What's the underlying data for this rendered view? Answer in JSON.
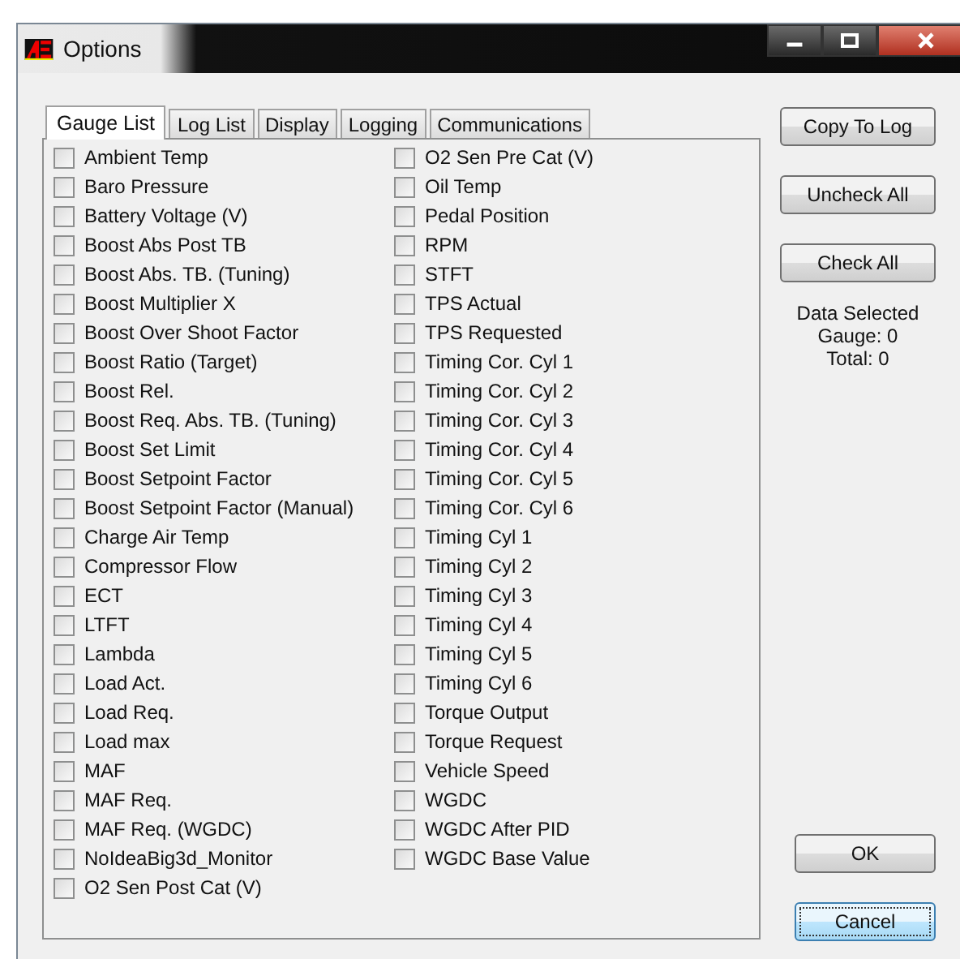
{
  "window": {
    "title": "Options"
  },
  "tabs": [
    {
      "label": "Gauge List",
      "selected": true
    },
    {
      "label": "Log List",
      "selected": false
    },
    {
      "label": "Display",
      "selected": false
    },
    {
      "label": "Logging",
      "selected": false
    },
    {
      "label": "Communications",
      "selected": false
    }
  ],
  "gauge_columns": [
    [
      {
        "label": "Ambient Temp",
        "checked": false
      },
      {
        "label": "Baro Pressure",
        "checked": false
      },
      {
        "label": "Battery Voltage (V)",
        "checked": false
      },
      {
        "label": "Boost Abs Post TB",
        "checked": false
      },
      {
        "label": "Boost Abs. TB. (Tuning)",
        "checked": false
      },
      {
        "label": "Boost Multiplier X",
        "checked": false
      },
      {
        "label": "Boost Over Shoot Factor",
        "checked": false
      },
      {
        "label": "Boost Ratio (Target)",
        "checked": false
      },
      {
        "label": "Boost Rel.",
        "checked": false
      },
      {
        "label": "Boost Req. Abs. TB. (Tuning)",
        "checked": false
      },
      {
        "label": "Boost Set Limit",
        "checked": false
      },
      {
        "label": "Boost Setpoint Factor",
        "checked": false
      },
      {
        "label": "Boost Setpoint Factor (Manual)",
        "checked": false
      },
      {
        "label": "Charge Air Temp",
        "checked": false
      },
      {
        "label": "Compressor Flow",
        "checked": false
      },
      {
        "label": "ECT",
        "checked": false
      },
      {
        "label": "LTFT",
        "checked": false
      },
      {
        "label": "Lambda",
        "checked": false
      },
      {
        "label": "Load Act.",
        "checked": false
      },
      {
        "label": "Load Req.",
        "checked": false
      },
      {
        "label": "Load max",
        "checked": false
      },
      {
        "label": "MAF",
        "checked": false
      },
      {
        "label": "MAF Req.",
        "checked": false
      },
      {
        "label": "MAF Req. (WGDC)",
        "checked": false
      },
      {
        "label": "NoIdeaBig3d_Monitor",
        "checked": false
      },
      {
        "label": "O2 Sen Post Cat (V)",
        "checked": false
      }
    ],
    [
      {
        "label": "O2 Sen Pre Cat (V)",
        "checked": false
      },
      {
        "label": "Oil Temp",
        "checked": false
      },
      {
        "label": "Pedal Position",
        "checked": false
      },
      {
        "label": "RPM",
        "checked": false
      },
      {
        "label": "STFT",
        "checked": false
      },
      {
        "label": "TPS Actual",
        "checked": false
      },
      {
        "label": "TPS Requested",
        "checked": false
      },
      {
        "label": "Timing Cor. Cyl 1",
        "checked": false
      },
      {
        "label": "Timing Cor. Cyl 2",
        "checked": false
      },
      {
        "label": "Timing Cor. Cyl 3",
        "checked": false
      },
      {
        "label": "Timing Cor. Cyl 4",
        "checked": false
      },
      {
        "label": "Timing Cor. Cyl 5",
        "checked": false
      },
      {
        "label": "Timing Cor. Cyl 6",
        "checked": false
      },
      {
        "label": "Timing Cyl 1",
        "checked": false
      },
      {
        "label": "Timing Cyl 2",
        "checked": false
      },
      {
        "label": "Timing Cyl 3",
        "checked": false
      },
      {
        "label": "Timing Cyl 4",
        "checked": false
      },
      {
        "label": "Timing Cyl 5",
        "checked": false
      },
      {
        "label": "Timing Cyl 6",
        "checked": false
      },
      {
        "label": "Torque Output",
        "checked": false
      },
      {
        "label": "Torque Request",
        "checked": false
      },
      {
        "label": "Vehicle Speed",
        "checked": false
      },
      {
        "label": "WGDC",
        "checked": false
      },
      {
        "label": "WGDC After PID",
        "checked": false
      },
      {
        "label": "WGDC Base Value",
        "checked": false
      }
    ]
  ],
  "side_buttons": [
    "Copy To Log",
    "Uncheck All",
    "Check All"
  ],
  "data_selected": [
    "Data Selected",
    "Gauge: 0",
    "Total: 0"
  ],
  "dialog_buttons": [
    {
      "label": "OK",
      "focused": false
    },
    {
      "label": "Cancel",
      "focused": true
    }
  ]
}
